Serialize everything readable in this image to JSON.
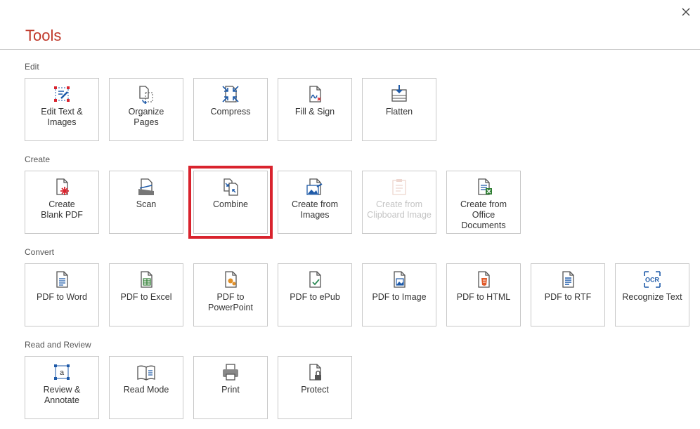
{
  "title": "Tools",
  "close_icon": "close-icon",
  "colors": {
    "title": "#c0392b",
    "highlight": "#d9232d",
    "icon_blue": "#1e5aa8"
  },
  "sections": [
    {
      "label": "Edit",
      "tools": [
        {
          "label": "Edit Text &\nImages",
          "icon": "edit-text-icon"
        },
        {
          "label": "Organize\nPages",
          "icon": "organize-pages-icon"
        },
        {
          "label": "Compress",
          "icon": "compress-icon"
        },
        {
          "label": "Fill & Sign",
          "icon": "fill-sign-icon"
        },
        {
          "label": "Flatten",
          "icon": "flatten-icon"
        }
      ]
    },
    {
      "label": "Create",
      "tools": [
        {
          "label": "Create\nBlank PDF",
          "icon": "blank-pdf-icon"
        },
        {
          "label": "Scan",
          "icon": "scan-icon"
        },
        {
          "label": "Combine",
          "icon": "combine-icon",
          "selected": true
        },
        {
          "label": "Create from\nImages",
          "icon": "images-icon"
        },
        {
          "label": "Create from\nClipboard Image",
          "icon": "clipboard-icon",
          "disabled": true
        },
        {
          "label": "Create from\nOffice\nDocuments",
          "icon": "office-docs-icon"
        }
      ]
    },
    {
      "label": "Convert",
      "tools": [
        {
          "label": "PDF to Word",
          "icon": "word-icon"
        },
        {
          "label": "PDF to Excel",
          "icon": "excel-icon"
        },
        {
          "label": "PDF to\nPowerPoint",
          "icon": "powerpoint-icon"
        },
        {
          "label": "PDF to ePub",
          "icon": "epub-icon"
        },
        {
          "label": "PDF to Image",
          "icon": "image-icon"
        },
        {
          "label": "PDF to HTML",
          "icon": "html-icon"
        },
        {
          "label": "PDF to RTF",
          "icon": "rtf-icon"
        },
        {
          "label": "Recognize Text",
          "icon": "ocr-icon"
        }
      ]
    },
    {
      "label": "Read and Review",
      "tools": [
        {
          "label": "Review &\nAnnotate",
          "icon": "annotate-icon"
        },
        {
          "label": "Read Mode",
          "icon": "read-mode-icon"
        },
        {
          "label": "Print",
          "icon": "print-icon"
        },
        {
          "label": "Protect",
          "icon": "protect-icon"
        }
      ]
    }
  ]
}
